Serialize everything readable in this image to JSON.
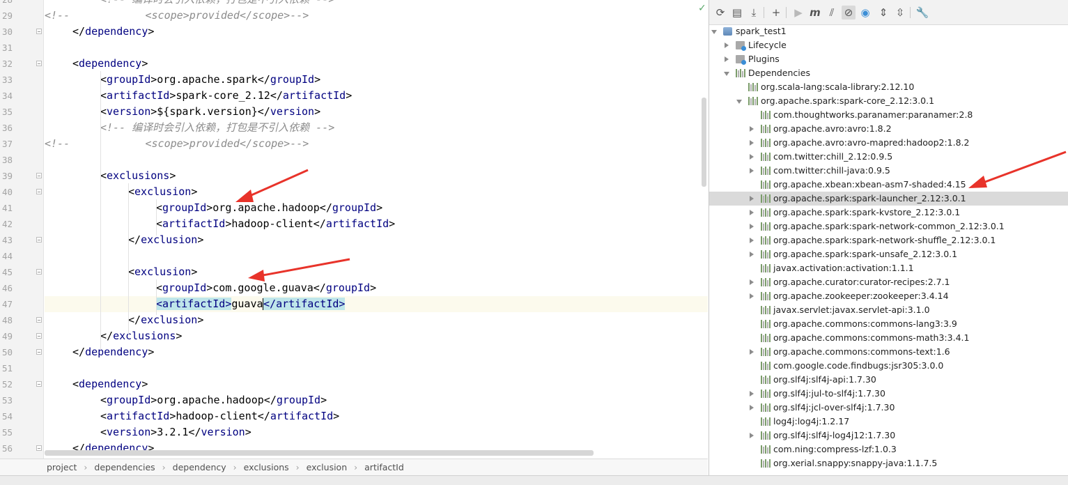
{
  "editor": {
    "status_icon": "check-icon",
    "lines": [
      {
        "n": "28",
        "indent": 2,
        "tokens": [
          [
            "cm",
            "<!-- 编译时会引入依赖，打包是不引入依赖 -->"
          ]
        ],
        "fold": false
      },
      {
        "n": "29",
        "indent": 0,
        "tokens": [
          [
            "cm",
            "<!--            <scope>provided</scope>-->"
          ]
        ],
        "fold": false
      },
      {
        "n": "30",
        "indent": 1,
        "tokens": [
          [
            "br",
            "</"
          ],
          [
            "t",
            "dependency"
          ],
          [
            "br",
            ">"
          ]
        ],
        "fold": true
      },
      {
        "n": "31",
        "indent": 0,
        "tokens": [],
        "fold": false
      },
      {
        "n": "32",
        "indent": 1,
        "tokens": [
          [
            "br",
            "<"
          ],
          [
            "t",
            "dependency"
          ],
          [
            "br",
            ">"
          ]
        ],
        "fold": true
      },
      {
        "n": "33",
        "indent": 2,
        "tokens": [
          [
            "br",
            "<"
          ],
          [
            "t",
            "groupId"
          ],
          [
            "br",
            ">org.apache.spark</"
          ],
          [
            "t",
            "groupId"
          ],
          [
            "br",
            ">"
          ]
        ],
        "fold": false
      },
      {
        "n": "34",
        "indent": 2,
        "tokens": [
          [
            "br",
            "<"
          ],
          [
            "t",
            "artifactId"
          ],
          [
            "br",
            ">spark-core_2.12</"
          ],
          [
            "t",
            "artifactId"
          ],
          [
            "br",
            ">"
          ]
        ],
        "fold": false
      },
      {
        "n": "35",
        "indent": 2,
        "tokens": [
          [
            "br",
            "<"
          ],
          [
            "t",
            "version"
          ],
          [
            "br",
            ">${spark.version}</"
          ],
          [
            "t",
            "version"
          ],
          [
            "br",
            ">"
          ]
        ],
        "fold": false
      },
      {
        "n": "36",
        "indent": 2,
        "tokens": [
          [
            "cm",
            "<!-- 编译时会引入依赖，打包是不引入依赖 -->"
          ]
        ],
        "fold": false
      },
      {
        "n": "37",
        "indent": 0,
        "tokens": [
          [
            "cm",
            "<!--            <scope>provided</scope>-->"
          ]
        ],
        "fold": false
      },
      {
        "n": "38",
        "indent": 0,
        "tokens": [],
        "fold": false
      },
      {
        "n": "39",
        "indent": 2,
        "tokens": [
          [
            "br",
            "<"
          ],
          [
            "t",
            "exclusions"
          ],
          [
            "br",
            ">"
          ]
        ],
        "fold": true
      },
      {
        "n": "40",
        "indent": 3,
        "tokens": [
          [
            "br",
            "<"
          ],
          [
            "t",
            "exclusion"
          ],
          [
            "br",
            ">"
          ]
        ],
        "fold": true
      },
      {
        "n": "41",
        "indent": 4,
        "tokens": [
          [
            "br",
            "<"
          ],
          [
            "t",
            "groupId"
          ],
          [
            "br",
            ">org.apache.hadoop</"
          ],
          [
            "t",
            "groupId"
          ],
          [
            "br",
            ">"
          ]
        ],
        "fold": false
      },
      {
        "n": "42",
        "indent": 4,
        "tokens": [
          [
            "br",
            "<"
          ],
          [
            "t",
            "artifactId"
          ],
          [
            "br",
            ">hadoop-client</"
          ],
          [
            "t",
            "artifactId"
          ],
          [
            "br",
            ">"
          ]
        ],
        "fold": false
      },
      {
        "n": "43",
        "indent": 3,
        "tokens": [
          [
            "br",
            "</"
          ],
          [
            "t",
            "exclusion"
          ],
          [
            "br",
            ">"
          ]
        ],
        "fold": true
      },
      {
        "n": "44",
        "indent": 0,
        "tokens": [],
        "fold": false
      },
      {
        "n": "45",
        "indent": 3,
        "tokens": [
          [
            "br",
            "<"
          ],
          [
            "t",
            "exclusion"
          ],
          [
            "br",
            ">"
          ]
        ],
        "fold": true
      },
      {
        "n": "46",
        "indent": 4,
        "tokens": [
          [
            "br",
            "<"
          ],
          [
            "t",
            "groupId"
          ],
          [
            "br",
            ">com.google.guava</"
          ],
          [
            "t",
            "groupId"
          ],
          [
            "br",
            ">"
          ]
        ],
        "fold": false
      },
      {
        "n": "47",
        "indent": 4,
        "tokens": [
          [
            "hl",
            "<artifactId>"
          ],
          [
            "br",
            "guava"
          ],
          [
            "caret",
            ""
          ],
          [
            "hl",
            "</artifactId>"
          ]
        ],
        "fold": false,
        "current": true
      },
      {
        "n": "48",
        "indent": 3,
        "tokens": [
          [
            "br",
            "</"
          ],
          [
            "t",
            "exclusion"
          ],
          [
            "br",
            ">"
          ]
        ],
        "fold": true
      },
      {
        "n": "49",
        "indent": 2,
        "tokens": [
          [
            "br",
            "</"
          ],
          [
            "t",
            "exclusions"
          ],
          [
            "br",
            ">"
          ]
        ],
        "fold": true
      },
      {
        "n": "50",
        "indent": 1,
        "tokens": [
          [
            "br",
            "</"
          ],
          [
            "t",
            "dependency"
          ],
          [
            "br",
            ">"
          ]
        ],
        "fold": true
      },
      {
        "n": "51",
        "indent": 0,
        "tokens": [],
        "fold": false
      },
      {
        "n": "52",
        "indent": 1,
        "tokens": [
          [
            "br",
            "<"
          ],
          [
            "t",
            "dependency"
          ],
          [
            "br",
            ">"
          ]
        ],
        "fold": true
      },
      {
        "n": "53",
        "indent": 2,
        "tokens": [
          [
            "br",
            "<"
          ],
          [
            "t",
            "groupId"
          ],
          [
            "br",
            ">org.apache.hadoop</"
          ],
          [
            "t",
            "groupId"
          ],
          [
            "br",
            ">"
          ]
        ],
        "fold": false
      },
      {
        "n": "54",
        "indent": 2,
        "tokens": [
          [
            "br",
            "<"
          ],
          [
            "t",
            "artifactId"
          ],
          [
            "br",
            ">hadoop-client</"
          ],
          [
            "t",
            "artifactId"
          ],
          [
            "br",
            ">"
          ]
        ],
        "fold": false
      },
      {
        "n": "55",
        "indent": 2,
        "tokens": [
          [
            "br",
            "<"
          ],
          [
            "t",
            "version"
          ],
          [
            "br",
            ">3.2.1</"
          ],
          [
            "t",
            "version"
          ],
          [
            "br",
            ">"
          ]
        ],
        "fold": false
      },
      {
        "n": "56",
        "indent": 1,
        "tokens": [
          [
            "br",
            "</"
          ],
          [
            "t",
            "dependency"
          ],
          [
            "br",
            ">"
          ]
        ],
        "fold": true
      }
    ]
  },
  "breadcrumb": [
    "project",
    "dependencies",
    "dependency",
    "exclusions",
    "exclusion",
    "artifactId"
  ],
  "maven": {
    "toolbar": [
      {
        "name": "reimport-icon",
        "glyph": "⟳"
      },
      {
        "name": "generate-sources-icon",
        "glyph": "▤"
      },
      {
        "name": "download-icon",
        "glyph": "⤓"
      },
      {
        "name": "add-icon",
        "glyph": "+"
      },
      {
        "name": "run-icon",
        "glyph": "▶"
      },
      {
        "name": "execute-goal-icon",
        "glyph": "m"
      },
      {
        "name": "toggle-offline-icon",
        "glyph": "⫽"
      },
      {
        "name": "skip-tests-icon",
        "glyph": "⊘"
      },
      {
        "name": "show-dependencies-icon",
        "glyph": "◉"
      },
      {
        "name": "expand-all-icon",
        "glyph": "⇕"
      },
      {
        "name": "collapse-all-icon",
        "glyph": "⇳"
      },
      {
        "name": "settings-wrench-icon",
        "glyph": "🔧"
      }
    ],
    "tree": [
      {
        "label": "spark_test1",
        "level": 0,
        "arrow": "d",
        "icon": "project"
      },
      {
        "label": "Lifecycle",
        "level": 1,
        "arrow": "r",
        "icon": "folder"
      },
      {
        "label": "Plugins",
        "level": 1,
        "arrow": "r",
        "icon": "folder"
      },
      {
        "label": "Dependencies",
        "level": 1,
        "arrow": "d",
        "icon": "lib"
      },
      {
        "label": "org.scala-lang:scala-library:2.12.10",
        "level": 2,
        "arrow": "",
        "icon": "bars"
      },
      {
        "label": "org.apache.spark:spark-core_2.12:3.0.1",
        "level": 2,
        "arrow": "d",
        "icon": "bars"
      },
      {
        "label": "com.thoughtworks.paranamer:paranamer:2.8",
        "level": 3,
        "arrow": "",
        "icon": "bars"
      },
      {
        "label": "org.apache.avro:avro:1.8.2",
        "level": 3,
        "arrow": "r",
        "icon": "bars"
      },
      {
        "label": "org.apache.avro:avro-mapred:hadoop2:1.8.2",
        "level": 3,
        "arrow": "r",
        "icon": "bars"
      },
      {
        "label": "com.twitter:chill_2.12:0.9.5",
        "level": 3,
        "arrow": "r",
        "icon": "bars"
      },
      {
        "label": "com.twitter:chill-java:0.9.5",
        "level": 3,
        "arrow": "r",
        "icon": "bars"
      },
      {
        "label": "org.apache.xbean:xbean-asm7-shaded:4.15",
        "level": 3,
        "arrow": "",
        "icon": "bars"
      },
      {
        "label": "org.apache.spark:spark-launcher_2.12:3.0.1",
        "level": 3,
        "arrow": "r",
        "icon": "bars",
        "selected": true
      },
      {
        "label": "org.apache.spark:spark-kvstore_2.12:3.0.1",
        "level": 3,
        "arrow": "r",
        "icon": "bars"
      },
      {
        "label": "org.apache.spark:spark-network-common_2.12:3.0.1",
        "level": 3,
        "arrow": "r",
        "icon": "bars"
      },
      {
        "label": "org.apache.spark:spark-network-shuffle_2.12:3.0.1",
        "level": 3,
        "arrow": "r",
        "icon": "bars"
      },
      {
        "label": "org.apache.spark:spark-unsafe_2.12:3.0.1",
        "level": 3,
        "arrow": "r",
        "icon": "bars"
      },
      {
        "label": "javax.activation:activation:1.1.1",
        "level": 3,
        "arrow": "",
        "icon": "bars"
      },
      {
        "label": "org.apache.curator:curator-recipes:2.7.1",
        "level": 3,
        "arrow": "r",
        "icon": "bars"
      },
      {
        "label": "org.apache.zookeeper:zookeeper:3.4.14",
        "level": 3,
        "arrow": "r",
        "icon": "bars"
      },
      {
        "label": "javax.servlet:javax.servlet-api:3.1.0",
        "level": 3,
        "arrow": "",
        "icon": "bars"
      },
      {
        "label": "org.apache.commons:commons-lang3:3.9",
        "level": 3,
        "arrow": "",
        "icon": "bars"
      },
      {
        "label": "org.apache.commons:commons-math3:3.4.1",
        "level": 3,
        "arrow": "",
        "icon": "bars"
      },
      {
        "label": "org.apache.commons:commons-text:1.6",
        "level": 3,
        "arrow": "r",
        "icon": "bars"
      },
      {
        "label": "com.google.code.findbugs:jsr305:3.0.0",
        "level": 3,
        "arrow": "",
        "icon": "bars"
      },
      {
        "label": "org.slf4j:slf4j-api:1.7.30",
        "level": 3,
        "arrow": "",
        "icon": "bars"
      },
      {
        "label": "org.slf4j:jul-to-slf4j:1.7.30",
        "level": 3,
        "arrow": "r",
        "icon": "bars"
      },
      {
        "label": "org.slf4j:jcl-over-slf4j:1.7.30",
        "level": 3,
        "arrow": "r",
        "icon": "bars"
      },
      {
        "label": "log4j:log4j:1.2.17",
        "level": 3,
        "arrow": "",
        "icon": "bars"
      },
      {
        "label": "org.slf4j:slf4j-log4j12:1.7.30",
        "level": 3,
        "arrow": "r",
        "icon": "bars"
      },
      {
        "label": "com.ning:compress-lzf:1.0.3",
        "level": 3,
        "arrow": "",
        "icon": "bars"
      },
      {
        "label": "org.xerial.snappy:snappy-java:1.1.7.5",
        "level": 3,
        "arrow": "",
        "icon": "bars"
      }
    ]
  },
  "colors": {
    "tag": "#000080",
    "comment": "#8c8c8c",
    "highlight": "#bfe6ea",
    "selected_row": "#dadada",
    "annotation_arrow": "#e8332a"
  }
}
